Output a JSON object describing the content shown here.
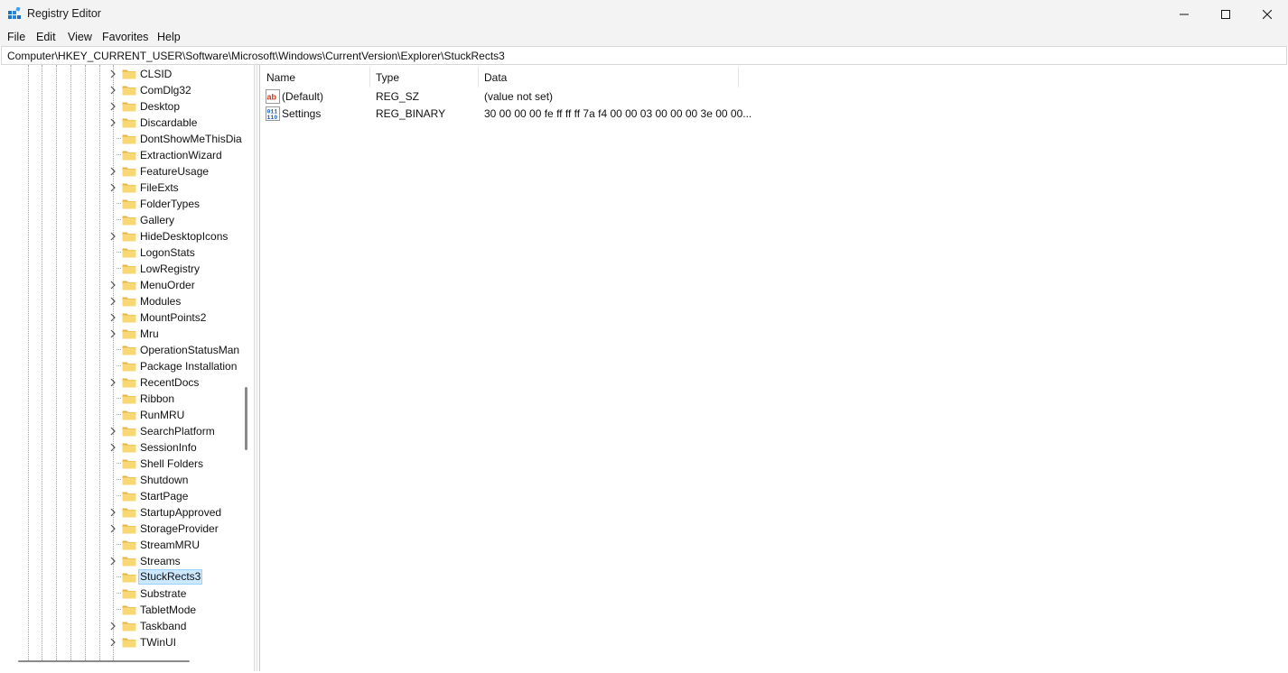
{
  "window": {
    "title": "Registry Editor"
  },
  "menu": {
    "file": "File",
    "edit": "Edit",
    "view": "View",
    "favorites": "Favorites",
    "help": "Help"
  },
  "address": {
    "path": "Computer\\HKEY_CURRENT_USER\\Software\\Microsoft\\Windows\\CurrentVersion\\Explorer\\StuckRects3"
  },
  "tree": {
    "items": [
      {
        "label": "CLSID",
        "expandable": true
      },
      {
        "label": "ComDlg32",
        "expandable": true
      },
      {
        "label": "Desktop",
        "expandable": true
      },
      {
        "label": "Discardable",
        "expandable": true
      },
      {
        "label": "DontShowMeThisDia",
        "expandable": false
      },
      {
        "label": "ExtractionWizard",
        "expandable": false
      },
      {
        "label": "FeatureUsage",
        "expandable": true
      },
      {
        "label": "FileExts",
        "expandable": true
      },
      {
        "label": "FolderTypes",
        "expandable": false
      },
      {
        "label": "Gallery",
        "expandable": false
      },
      {
        "label": "HideDesktopIcons",
        "expandable": true
      },
      {
        "label": "LogonStats",
        "expandable": false
      },
      {
        "label": "LowRegistry",
        "expandable": false
      },
      {
        "label": "MenuOrder",
        "expandable": true
      },
      {
        "label": "Modules",
        "expandable": true
      },
      {
        "label": "MountPoints2",
        "expandable": true
      },
      {
        "label": "Mru",
        "expandable": true
      },
      {
        "label": "OperationStatusMan",
        "expandable": false
      },
      {
        "label": "Package Installation",
        "expandable": false
      },
      {
        "label": "RecentDocs",
        "expandable": true
      },
      {
        "label": "Ribbon",
        "expandable": false
      },
      {
        "label": "RunMRU",
        "expandable": false
      },
      {
        "label": "SearchPlatform",
        "expandable": true
      },
      {
        "label": "SessionInfo",
        "expandable": true
      },
      {
        "label": "Shell Folders",
        "expandable": false
      },
      {
        "label": "Shutdown",
        "expandable": false
      },
      {
        "label": "StartPage",
        "expandable": false
      },
      {
        "label": "StartupApproved",
        "expandable": true
      },
      {
        "label": "StorageProvider",
        "expandable": true
      },
      {
        "label": "StreamMRU",
        "expandable": false
      },
      {
        "label": "Streams",
        "expandable": true
      },
      {
        "label": "StuckRects3",
        "expandable": false,
        "selected": true
      },
      {
        "label": "Substrate",
        "expandable": false
      },
      {
        "label": "TabletMode",
        "expandable": false
      },
      {
        "label": "Taskband",
        "expandable": true
      },
      {
        "label": "TWinUI",
        "expandable": true
      }
    ]
  },
  "list": {
    "headers": {
      "name": "Name",
      "type": "Type",
      "data": "Data"
    },
    "rows": [
      {
        "icon": "string-value-icon",
        "name": "(Default)",
        "type": "REG_SZ",
        "data": "(value not set)"
      },
      {
        "icon": "binary-value-icon",
        "name": "Settings",
        "type": "REG_BINARY",
        "data": "30 00 00 00 fe ff ff ff 7a f4 00 00 03 00 00 00 3e 00 00..."
      }
    ]
  },
  "colors": {
    "accent": "#0078d4",
    "folder": "#f8d775",
    "selection": "#cce8ff"
  }
}
